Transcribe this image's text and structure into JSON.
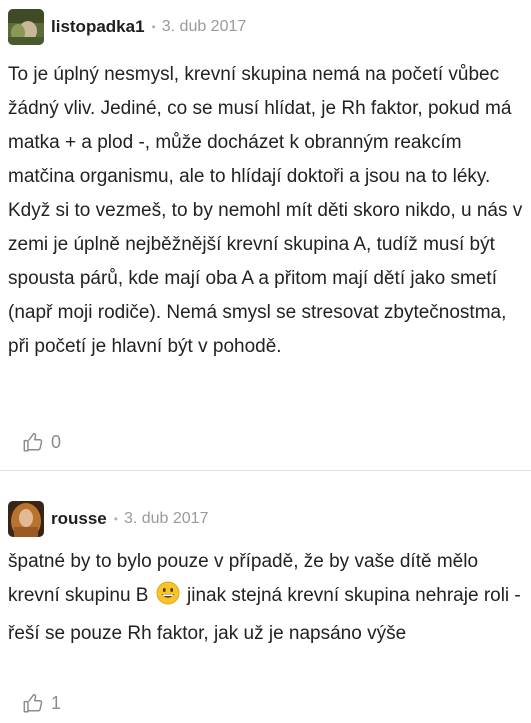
{
  "comments": [
    {
      "username": "listopadka1",
      "separator": "•",
      "date": "3. dub 2017",
      "paragraphs": [
        "To je úplný nesmysl, krevní skupina nemá na početí vůbec žádný vliv. Jediné, co se musí hlídat, je Rh faktor, pokud má matka + a plod -, může docházet k obranným reakcím matčina organismu, ale to hlídají doktoři a jsou na to léky.",
        "Když si to vezmeš, to by nemohl mít děti skoro nikdo, u nás v zemi je úplně nejběžnější krevní skupina A, tudíž musí být spousta párů, kde mají oba A a přitom mají dětí jako smetí (např moji rodiče). Nemá smysl se stresovat zbytečnostma, při početí je hlavní být v pohodě."
      ],
      "likes": "0",
      "avatar_icon": "avatar-photo-icon",
      "like_icon": "thumbs-up-icon"
    },
    {
      "username": "rousse",
      "separator": "•",
      "date": "3. dub 2017",
      "text_before": "špatné by to bylo pouze v případě, že by vaše dítě mělo krevní skupinu B",
      "text_after": "jinak stejná krevní skupina nehraje roli - řeší se pouze Rh faktor, jak už je napsáno výše",
      "emoji_icon": "grinning-face-emoji-icon",
      "likes": "1",
      "avatar_icon": "avatar-photo-icon",
      "like_icon": "thumbs-up-icon"
    }
  ],
  "colors": {
    "text": "#222222",
    "meta": "#9a9a9a",
    "divider": "#e2e2e2",
    "like": "#8c8c8c"
  }
}
